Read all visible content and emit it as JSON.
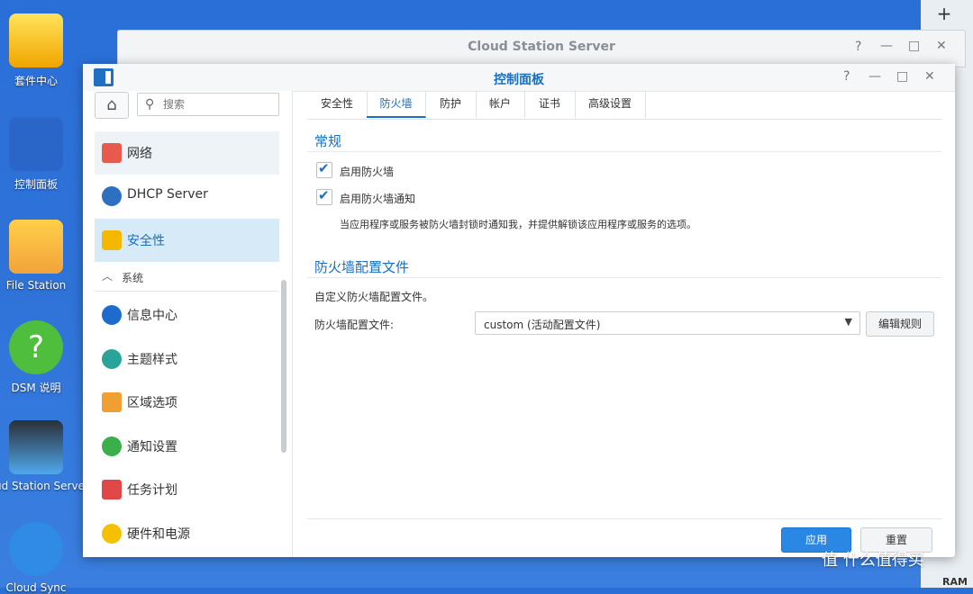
{
  "desktop": {
    "icons": [
      {
        "label": "套件中心",
        "icon": "package-center-icon"
      },
      {
        "label": "控制面板",
        "icon": "control-panel-icon"
      },
      {
        "label": "File Station",
        "icon": "file-station-icon"
      },
      {
        "label": "DSM 说明",
        "icon": "dsm-help-icon"
      },
      {
        "label": "ud Station Serve",
        "icon": "cloud-station-server-icon"
      },
      {
        "label": "Cloud Sync",
        "icon": "cloud-sync-icon"
      }
    ],
    "widget_strip": {
      "plus": "+",
      "ram_label": "RAM"
    }
  },
  "back_window": {
    "title": "Cloud Station Server",
    "help": "?",
    "minimize": "—",
    "maximize": "□",
    "close": "✕"
  },
  "window": {
    "title": "控制面板",
    "help": "?",
    "minimize": "—",
    "maximize": "□",
    "close": "✕"
  },
  "sidebar": {
    "search_placeholder": "搜索",
    "items_top": [
      {
        "label": "网络",
        "icon": "network-icon"
      },
      {
        "label": "DHCP Server",
        "icon": "dhcp-server-icon"
      },
      {
        "label": "安全性",
        "icon": "security-shield-icon"
      }
    ],
    "section_label": "系统",
    "items_system": [
      {
        "label": "信息中心",
        "icon": "info-center-icon"
      },
      {
        "label": "主题样式",
        "icon": "theme-palette-icon"
      },
      {
        "label": "区域选项",
        "icon": "regional-options-icon"
      },
      {
        "label": "通知设置",
        "icon": "notification-icon"
      },
      {
        "label": "任务计划",
        "icon": "task-scheduler-icon"
      },
      {
        "label": "硬件和电源",
        "icon": "hardware-power-icon"
      }
    ]
  },
  "tabs": [
    "安全性",
    "防火墙",
    "防护",
    "帐户",
    "证书",
    "高级设置"
  ],
  "active_tab": "防火墙",
  "general": {
    "title": "常规",
    "enable_firewall": "启用防火墙",
    "enable_notification": "启用防火墙通知",
    "notification_note": "当应用程序或服务被防火墙封锁时通知我，并提供解锁该应用程序或服务的选项。"
  },
  "profile": {
    "title": "防火墙配置文件",
    "description": "自定义防火墙配置文件。",
    "field_label": "防火墙配置文件:",
    "selected": "custom (活动配置文件)",
    "edit_rules": "编辑规则"
  },
  "footer": {
    "apply": "应用",
    "reset": "重置"
  },
  "watermark": "值 什么值得买",
  "colors": {
    "accent": "#1a6fbf",
    "primary_button": "#2a88e4",
    "active_nav": "#d6eaf8"
  }
}
